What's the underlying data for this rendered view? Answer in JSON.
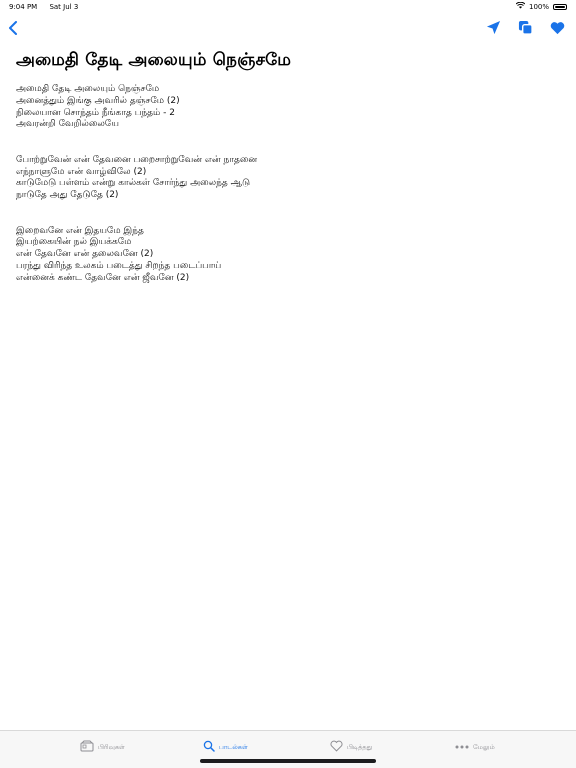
{
  "status": {
    "time": "9:04 PM",
    "date": "Sat Jul 3",
    "battery": "100%"
  },
  "colors": {
    "accent": "#1a73e8",
    "inactive": "#8e8e93"
  },
  "nav": {
    "back_icon": "chevron-left-icon",
    "actions": [
      "send-icon",
      "copy-icon",
      "heart-icon"
    ]
  },
  "title": "அமைதி தேடி அலையும் நெஞ்சமே",
  "stanzas": [
    {
      "lines": [
        "அமைதி தேடி அலையும் நெஞ்சமே",
        "அனைத்தும் இங்கு அவரில் தஞ்சமே (2)",
        "நிலையான சொந்தம் நீங்காத பந்தம் - 2",
        "அவரன்றி வேறில்லையே"
      ]
    },
    {
      "lines": [
        "போற்றுவேன் என் தேவனை பறைசாற்றுவேன் என் நாதனை",
        "எந்நாளுமே என் வாழ்விலே (2)",
        "காடுமேடு பள்ளம் என்று கால்கள் சோர்ந்து அலைந்த ஆடு",
        "நாடுதே அது தேடுதே (2)"
      ]
    },
    {
      "lines": [
        "இறைவனே என் இதயமே இந்த",
        "இயற்கையின் நல் இயக்கமே",
        "என் தேவனே என் தலைவனே (2)",
        "பரந்து விரிந்த உலகம் படைத்து சிறந்த படைப்பாய்",
        "என்னைக் கண்ட தேவனே என் ஜீவனே (2)"
      ]
    }
  ],
  "tabs": [
    {
      "label": "பிரிவுகள்",
      "icon": "categories-icon",
      "active": false
    },
    {
      "label": "பாடல்கள்",
      "icon": "search-icon",
      "active": true
    },
    {
      "label": "பிடித்தது",
      "icon": "heart-outline-icon",
      "active": false
    },
    {
      "label": "மேலும்",
      "icon": "more-icon",
      "active": false
    }
  ]
}
